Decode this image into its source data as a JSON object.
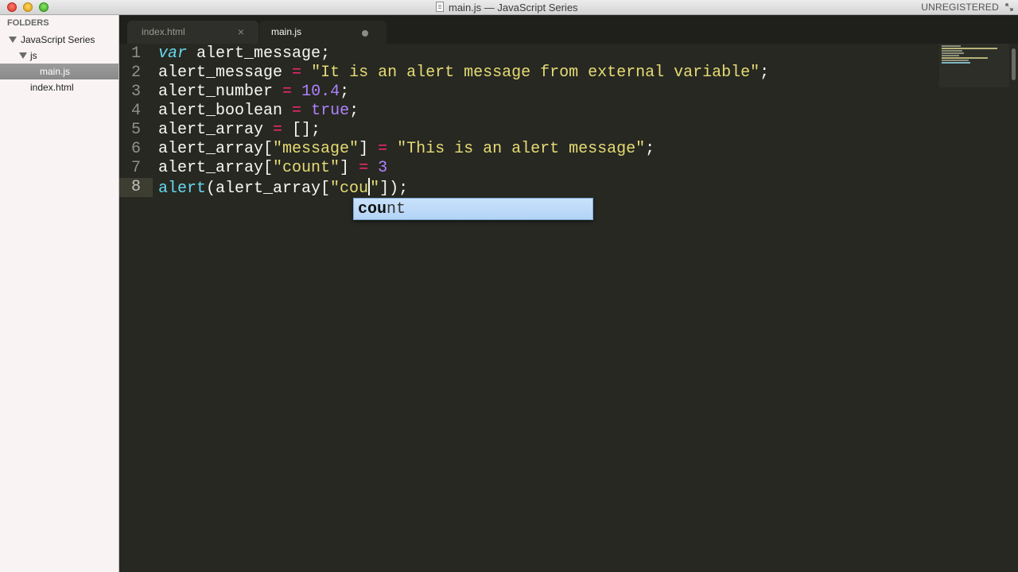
{
  "window": {
    "title": "main.js — JavaScript Series",
    "registration": "UNREGISTERED"
  },
  "sidebar": {
    "heading": "FOLDERS",
    "items": [
      {
        "label": "JavaScript Series",
        "type": "folder",
        "expanded": true
      },
      {
        "label": "js",
        "type": "folder",
        "expanded": true
      },
      {
        "label": "main.js",
        "type": "file",
        "selected": true
      },
      {
        "label": "index.html",
        "type": "file",
        "selected": false
      }
    ]
  },
  "tabs": [
    {
      "label": "index.html",
      "active": false,
      "icon": "close-icon"
    },
    {
      "label": "main.js",
      "active": true,
      "icon": "unsaved-dot-icon"
    }
  ],
  "editor": {
    "current_line": 8,
    "line_numbers": [
      "1",
      "2",
      "3",
      "4",
      "5",
      "6",
      "7",
      "8"
    ],
    "lines": [
      "var alert_message;",
      "alert_message = \"It is an alert message from external variable\";",
      "alert_number = 10.4;",
      "alert_boolean = true;",
      "alert_array = [];",
      "alert_array[\"message\"] = \"This is an alert message\";",
      "alert_array[\"count\"] = 3",
      "alert(alert_array[\"cou\"]);"
    ]
  },
  "autocomplete": {
    "suggestion": "count",
    "typed": "cou",
    "rest": "nt"
  },
  "colors": {
    "background": "#272822",
    "keyword": "#66d9ef",
    "operator": "#f92672",
    "string": "#e6db74",
    "number": "#ae81ff",
    "text": "#f8f8f2"
  }
}
